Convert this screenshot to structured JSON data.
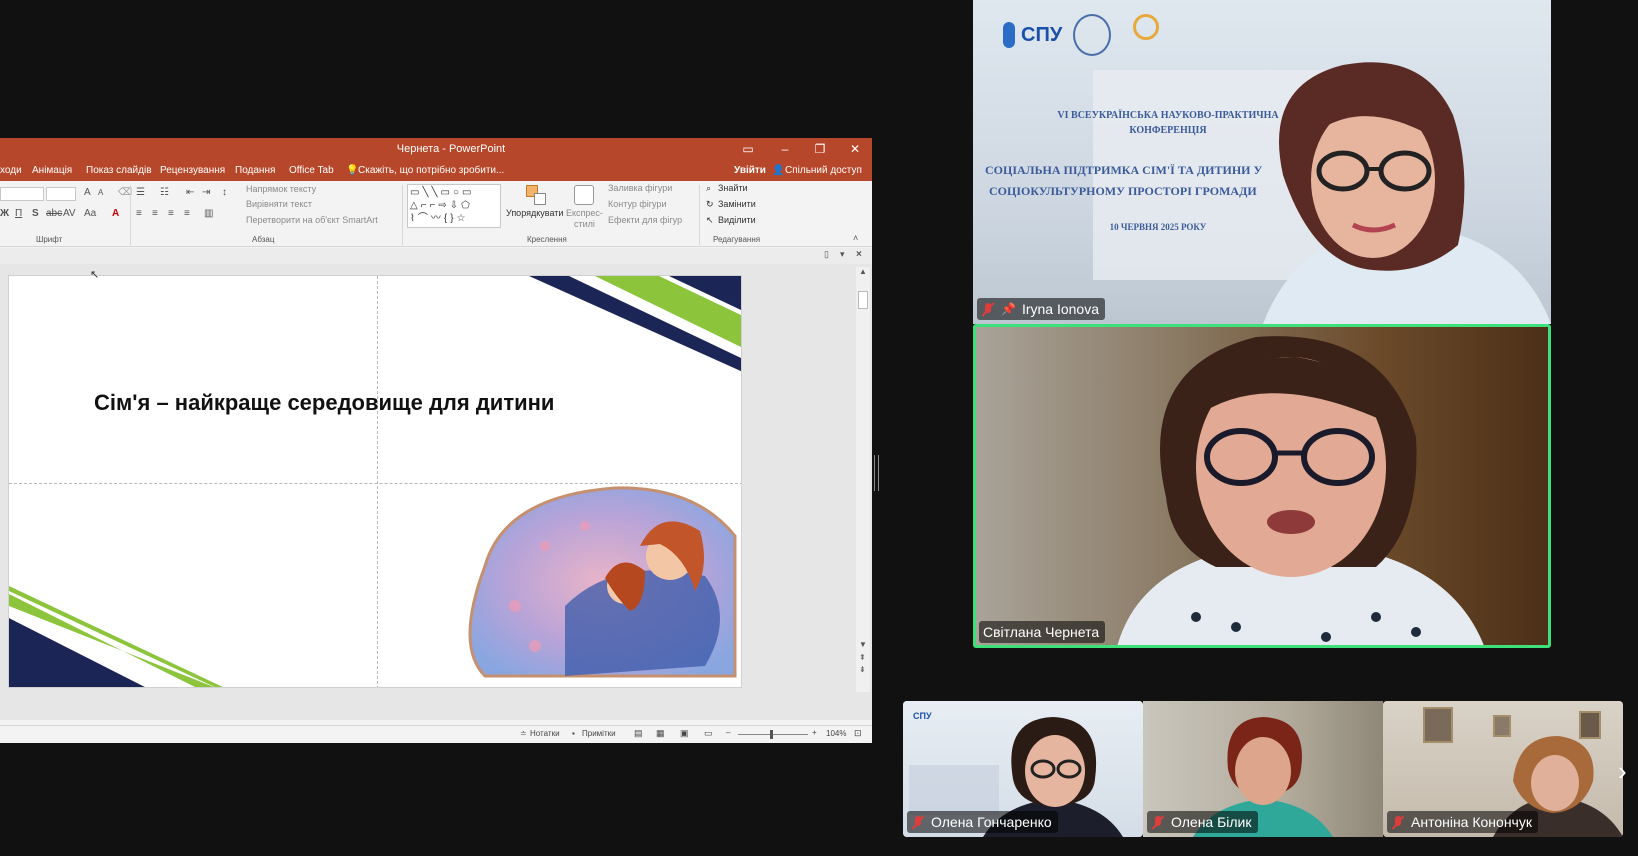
{
  "ppt": {
    "window_title": "Чернета - PowerPoint",
    "tabs": [
      "ходи",
      "Анімація",
      "Показ слайдів",
      "Рецензування",
      "Подання",
      "Office Tab"
    ],
    "tell_me": "Скажіть, що потрібно зробити...",
    "sign_in": "Увійти",
    "share": "Спільний доступ",
    "ribbon": {
      "group_font": "Шрифт",
      "group_paragraph": "Абзац",
      "group_drawing": "Креслення",
      "group_editing": "Редагування",
      "text_direction": "Напрямок тексту",
      "align_text": "Вирівняти текст",
      "convert_smartart": "Перетворити на об'єкт SmartArt",
      "arrange": "Упорядкувати",
      "quick_styles_1": "Експрес-",
      "quick_styles_2": "стилі",
      "shape_fill": "Заливка фігури",
      "shape_outline": "Контур фігури",
      "shape_effects": "Ефекти для фігур",
      "find": "Знайти",
      "replace": "Замінити",
      "select": "Виділити"
    },
    "slide": {
      "title": "Сім'я – найкраще середовище для дитини"
    },
    "status": {
      "notes": "Нотатки",
      "comments": "Примітки",
      "zoom": "104%"
    },
    "colors": {
      "accent": "#b7472a",
      "stripe_navy": "#1c2656",
      "stripe_green": "#8cc43c"
    }
  },
  "participants": {
    "main_top": {
      "name": "Iryna Ionova",
      "muted": true,
      "pinned": true
    },
    "main_bottom": {
      "name": "Світлана Чернета",
      "muted": false,
      "active_speaker": true
    },
    "strip": [
      {
        "name": "Олена Гончаренко",
        "muted": true
      },
      {
        "name": "Олена Білик",
        "muted": true
      },
      {
        "name": "Антоніна Конончук",
        "muted": true
      }
    ]
  },
  "background_banner": {
    "logo_text": "СПУ",
    "line1": "VI ВСЕУКРАЇНСЬКА НАУКОВО-ПРАКТИЧНА",
    "line2": "КОНФЕРЕНЦІЯ",
    "line3": "СОЦІАЛЬНА ПІДТРИМКА СІМ'Ї ТА ДИТИНИ У",
    "line4": "СОЦІОКУЛЬТУРНОМУ ПРОСТОРІ ГРОМАДИ",
    "date": "10 ЧЕРВНЯ 2025 РОКУ"
  },
  "colors": {
    "active_border": "#3ee07a",
    "muted_red": "#e03c3c"
  },
  "icons": {
    "next": "chevron-right-icon"
  }
}
